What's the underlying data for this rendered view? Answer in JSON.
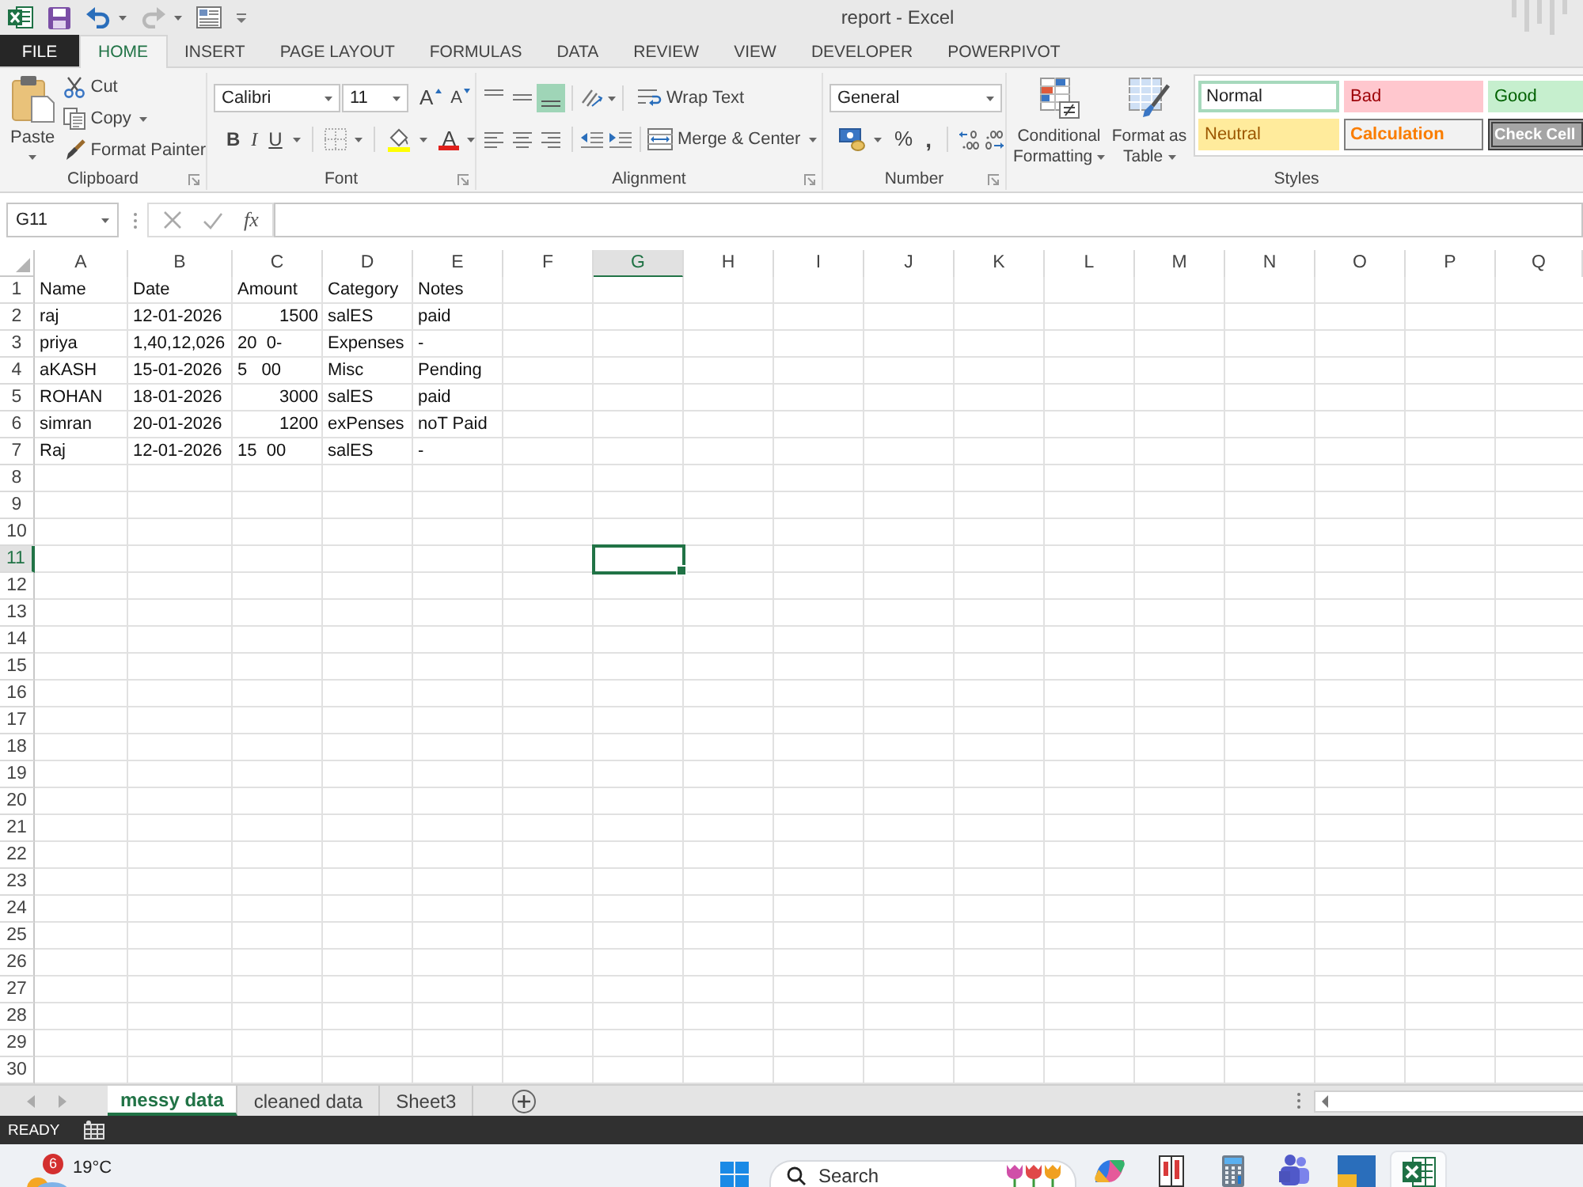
{
  "title_bar": {
    "title": "report - Excel",
    "quick_access": [
      {
        "kind": "save",
        "disabled": false
      },
      {
        "kind": "undo",
        "disabled": false
      },
      {
        "kind": "redo",
        "disabled": true
      },
      {
        "kind": "form",
        "disabled": false
      },
      {
        "kind": "customize",
        "disabled": false
      }
    ]
  },
  "tabs": [
    {
      "label": "FILE",
      "kind": "file",
      "selected": false
    },
    {
      "label": "HOME",
      "kind": "tab",
      "selected": true
    },
    {
      "label": "INSERT",
      "kind": "tab",
      "selected": false
    },
    {
      "label": "PAGE LAYOUT",
      "kind": "tab",
      "selected": false
    },
    {
      "label": "FORMULAS",
      "kind": "tab",
      "selected": false
    },
    {
      "label": "DATA",
      "kind": "tab",
      "selected": false
    },
    {
      "label": "REVIEW",
      "kind": "tab",
      "selected": false
    },
    {
      "label": "VIEW",
      "kind": "tab",
      "selected": false
    },
    {
      "label": "DEVELOPER",
      "kind": "tab",
      "selected": false
    },
    {
      "label": "POWERPIVOT",
      "kind": "tab",
      "selected": false
    }
  ],
  "ribbon": {
    "clipboard": {
      "label": "Clipboard",
      "paste": "Paste",
      "cut": "Cut",
      "copy": "Copy",
      "format_painter": "Format Painter"
    },
    "font": {
      "label": "Font",
      "font_name": "Calibri",
      "font_size": "11",
      "grow_font": "A",
      "shrink_font": "A",
      "bold": "B",
      "italic": "I",
      "underline": "U",
      "font_color": "A"
    },
    "alignment": {
      "label": "Alignment",
      "vertical": [
        {
          "kind": "top",
          "selected": false
        },
        {
          "kind": "middle",
          "selected": false
        },
        {
          "kind": "bottom",
          "selected": true
        }
      ],
      "horizontal": [
        {
          "kind": "left",
          "selected": false
        },
        {
          "kind": "center",
          "selected": false
        },
        {
          "kind": "right",
          "selected": false
        }
      ],
      "wrap_text": "Wrap Text",
      "merge_center": "Merge & Center"
    },
    "number": {
      "label": "Number",
      "format": "General",
      "percent": "%",
      "comma": ","
    },
    "styles": {
      "label": "Styles",
      "conditional_formatting": "Conditional Formatting",
      "format_as_table": "Format as Table",
      "cell_styles": [
        {
          "label": "Normal",
          "kind": "normal",
          "selected": true
        },
        {
          "label": "Bad",
          "kind": "bad",
          "selected": false
        },
        {
          "label": "Good",
          "kind": "good",
          "selected": false
        },
        {
          "label": "Neutral",
          "kind": "neutral",
          "selected": false
        },
        {
          "label": "Calculation",
          "kind": "calculation",
          "selected": false
        },
        {
          "label": "Check Cell",
          "kind": "check",
          "selected": false
        }
      ]
    }
  },
  "formula_bar": {
    "name_box": "G11",
    "insert_function": "fx"
  },
  "sheet": {
    "columns": [
      {
        "label": "A",
        "selected": false
      },
      {
        "label": "B",
        "selected": false
      },
      {
        "label": "C",
        "selected": false
      },
      {
        "label": "D",
        "selected": false
      },
      {
        "label": "E",
        "selected": false
      },
      {
        "label": "F",
        "selected": false
      },
      {
        "label": "G",
        "selected": true
      },
      {
        "label": "H",
        "selected": false
      },
      {
        "label": "I",
        "selected": false
      },
      {
        "label": "J",
        "selected": false
      },
      {
        "label": "K",
        "selected": false
      },
      {
        "label": "L",
        "selected": false
      },
      {
        "label": "M",
        "selected": false
      },
      {
        "label": "N",
        "selected": false
      },
      {
        "label": "O",
        "selected": false
      },
      {
        "label": "P",
        "selected": false
      },
      {
        "label": "Q",
        "selected": false
      }
    ],
    "rows": [
      {
        "number": "1",
        "selected": false,
        "cells": [
          {
            "text": "Name",
            "kind": "text"
          },
          {
            "text": "Date",
            "kind": "text"
          },
          {
            "text": "Amount",
            "kind": "text"
          },
          {
            "text": "Category",
            "kind": "text"
          },
          {
            "text": "Notes",
            "kind": "text"
          }
        ]
      },
      {
        "number": "2",
        "selected": false,
        "cells": [
          {
            "text": "raj",
            "kind": "text"
          },
          {
            "text": "12-01-2026",
            "kind": "text"
          },
          {
            "text": "1500",
            "kind": "number"
          },
          {
            "text": "salES",
            "kind": "text"
          },
          {
            "text": "paid",
            "kind": "text"
          }
        ]
      },
      {
        "number": "3",
        "selected": false,
        "cells": [
          {
            "text": "priya",
            "kind": "text"
          },
          {
            "text": "1,40,12,026",
            "kind": "text"
          },
          {
            "text": "20  0-",
            "kind": "text"
          },
          {
            "text": "Expenses",
            "kind": "text"
          },
          {
            "text": "-",
            "kind": "text"
          }
        ]
      },
      {
        "number": "4",
        "selected": false,
        "cells": [
          {
            "text": "aKASH",
            "kind": "text"
          },
          {
            "text": "15-01-2026",
            "kind": "text"
          },
          {
            "text": "5   00",
            "kind": "text"
          },
          {
            "text": "Misc",
            "kind": "text"
          },
          {
            "text": "Pending",
            "kind": "text"
          }
        ]
      },
      {
        "number": "5",
        "selected": false,
        "cells": [
          {
            "text": "ROHAN",
            "kind": "text"
          },
          {
            "text": "18-01-2026",
            "kind": "text"
          },
          {
            "text": "3000",
            "kind": "number"
          },
          {
            "text": "salES",
            "kind": "text"
          },
          {
            "text": "paid",
            "kind": "text"
          }
        ]
      },
      {
        "number": "6",
        "selected": false,
        "cells": [
          {
            "text": "simran",
            "kind": "text"
          },
          {
            "text": "20-01-2026",
            "kind": "text"
          },
          {
            "text": "1200",
            "kind": "number"
          },
          {
            "text": "exPenses",
            "kind": "text"
          },
          {
            "text": "noT Paid",
            "kind": "text"
          }
        ]
      },
      {
        "number": "7",
        "selected": false,
        "cells": [
          {
            "text": "Raj",
            "kind": "text"
          },
          {
            "text": "12-01-2026",
            "kind": "text"
          },
          {
            "text": "15  00",
            "kind": "text"
          },
          {
            "text": "salES",
            "kind": "text"
          },
          {
            "text": "-",
            "kind": "text"
          }
        ]
      },
      {
        "number": "8",
        "selected": false
      },
      {
        "number": "9",
        "selected": false
      },
      {
        "number": "10",
        "selected": false
      },
      {
        "number": "11",
        "selected": true
      },
      {
        "number": "12",
        "selected": false
      },
      {
        "number": "13",
        "selected": false
      },
      {
        "number": "14",
        "selected": false
      },
      {
        "number": "15",
        "selected": false
      },
      {
        "number": "16",
        "selected": false
      },
      {
        "number": "17",
        "selected": false
      },
      {
        "number": "18",
        "selected": false
      },
      {
        "number": "19",
        "selected": false
      },
      {
        "number": "20",
        "selected": false
      },
      {
        "number": "21",
        "selected": false
      },
      {
        "number": "22",
        "selected": false
      },
      {
        "number": "23",
        "selected": false
      },
      {
        "number": "24",
        "selected": false
      },
      {
        "number": "25",
        "selected": false
      },
      {
        "number": "26",
        "selected": false
      },
      {
        "number": "27",
        "selected": false
      },
      {
        "number": "28",
        "selected": false
      },
      {
        "number": "29",
        "selected": false
      },
      {
        "number": "30",
        "selected": false
      }
    ]
  },
  "sheet_tabs": [
    {
      "label": "messy data",
      "selected": true
    },
    {
      "label": "cleaned data",
      "selected": false
    },
    {
      "label": "Sheet3",
      "selected": false
    }
  ],
  "status_bar": {
    "mode": "READY"
  },
  "taskbar": {
    "weather": {
      "temperature": "19°C",
      "badge": "6"
    },
    "search": {
      "placeholder": "Search"
    },
    "apps": [
      {
        "kind": "copilot",
        "selected": false
      },
      {
        "kind": "book",
        "selected": false
      },
      {
        "kind": "calculator",
        "selected": false
      },
      {
        "kind": "teams",
        "selected": false
      },
      {
        "kind": "tiles",
        "selected": false
      },
      {
        "kind": "excel",
        "selected": true
      }
    ]
  }
}
